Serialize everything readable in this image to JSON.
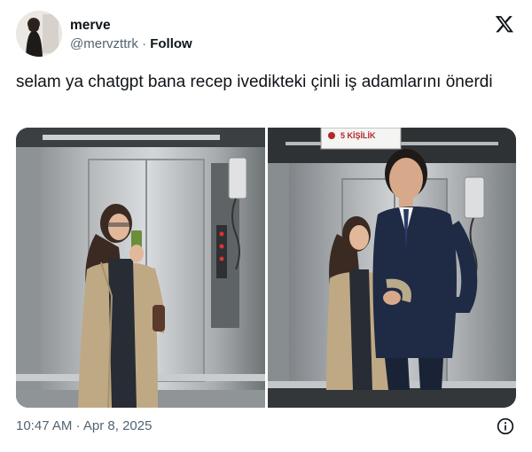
{
  "author": {
    "display_name": "merve",
    "handle": "@mervzttrk",
    "separator": "·",
    "follow_label": "Follow"
  },
  "tweet": {
    "text": "selam ya chatgpt bana recep ivedikteki çinli iş adamlarını önerdi"
  },
  "media": {
    "images": [
      {
        "label": "selfie-alone"
      },
      {
        "label": "selfie-with-man",
        "sign_text": "5 KİŞİLİK"
      }
    ]
  },
  "footer": {
    "timestamp": "10:47 AM · Apr 8, 2025"
  },
  "icons": {
    "brand": "x-logo-icon",
    "info": "info-icon"
  },
  "colors": {
    "text": "#0f1419",
    "secondary": "#536471"
  }
}
